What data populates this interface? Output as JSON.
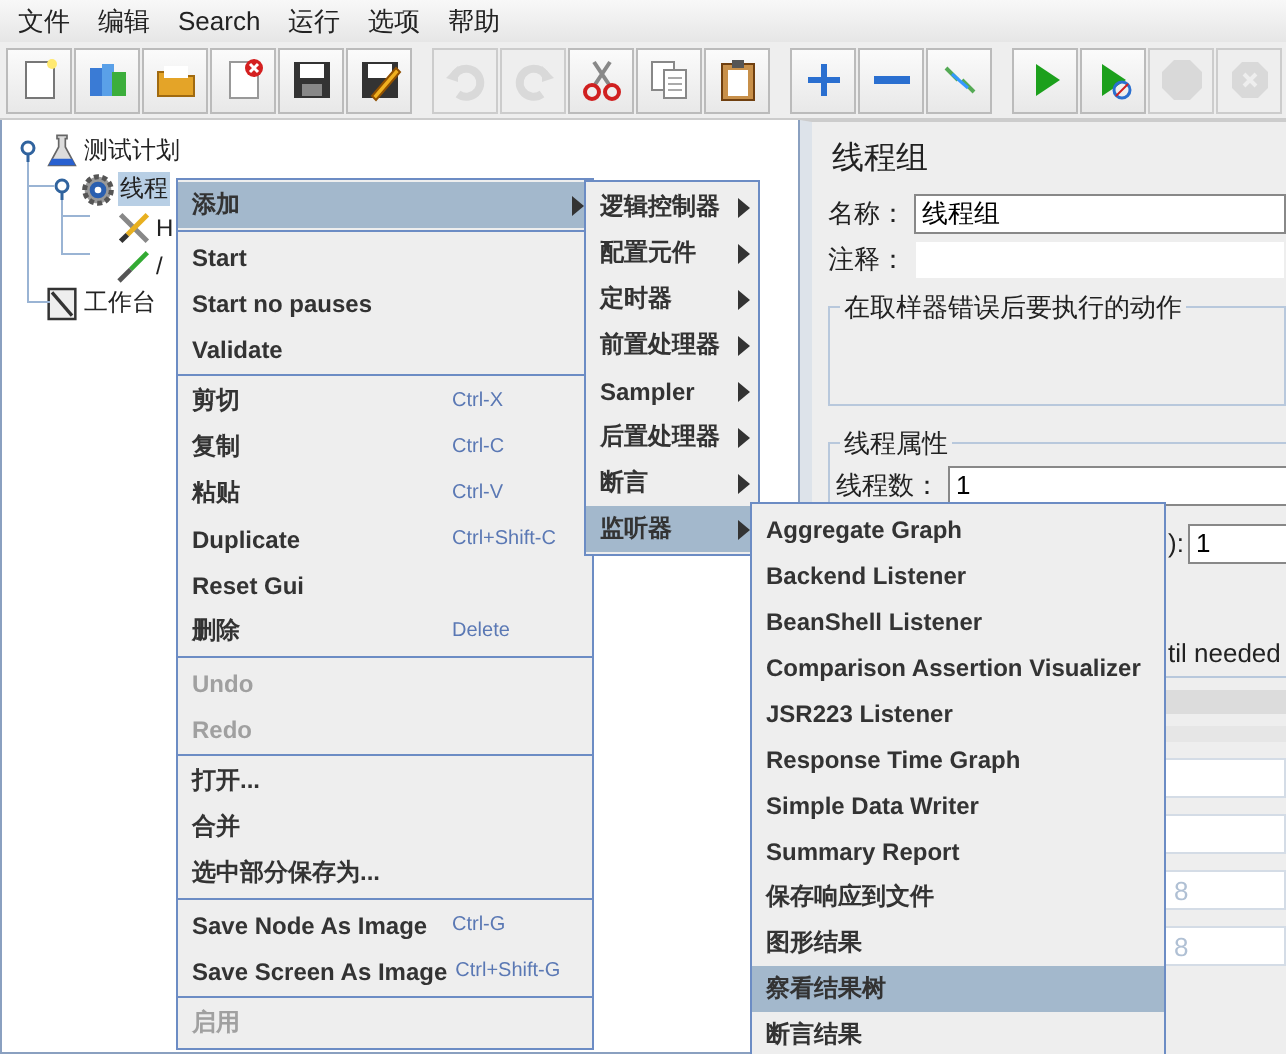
{
  "menubar": [
    "文件",
    "编辑",
    "Search",
    "运行",
    "选项",
    "帮助"
  ],
  "toolbar": [
    [
      {
        "kind": "new",
        "disabled": false
      },
      {
        "kind": "templates",
        "disabled": false
      },
      {
        "kind": "open",
        "disabled": false
      },
      {
        "kind": "close",
        "disabled": false
      },
      {
        "kind": "save",
        "disabled": false
      },
      {
        "kind": "save-as",
        "disabled": false
      }
    ],
    [
      {
        "kind": "undo",
        "disabled": true
      },
      {
        "kind": "redo",
        "disabled": true
      },
      {
        "kind": "cut",
        "disabled": false
      },
      {
        "kind": "copy",
        "disabled": false
      },
      {
        "kind": "paste",
        "disabled": false
      }
    ],
    [
      {
        "kind": "expand",
        "disabled": false
      },
      {
        "kind": "collapse",
        "disabled": false
      },
      {
        "kind": "toggle",
        "disabled": false
      }
    ],
    [
      {
        "kind": "start",
        "disabled": false
      },
      {
        "kind": "start-no-pause",
        "disabled": false
      },
      {
        "kind": "stop",
        "disabled": true
      },
      {
        "kind": "shutdown",
        "disabled": true
      }
    ]
  ],
  "tree": [
    {
      "label": "测试计划",
      "kind": "plan",
      "selected": false,
      "children": [
        {
          "label": "线程",
          "kind": "threads",
          "selected": true,
          "children": [
            {
              "label": "H",
              "kind": "tools",
              "selected": false
            },
            {
              "label": "/",
              "kind": "dropper",
              "selected": false
            }
          ]
        }
      ]
    },
    {
      "label": "工作台",
      "kind": "workbench",
      "selected": false
    }
  ],
  "panel": {
    "title": "线程组",
    "name_label": "名称：",
    "name_value": "线程组",
    "comment_label": "注释：",
    "error_group_title": "在取样器错误后要执行的动作",
    "thread_group_title": "线程属性",
    "threads_label": "线程数：",
    "threads_value": "1",
    "partial_label": "):",
    "partial_value": "1",
    "partial_text": "til needed",
    "faded_values": [
      "8",
      "8"
    ]
  },
  "context_menus": [
    {
      "items": [
        {
          "kind": "submenu",
          "label": "添加",
          "selected": true,
          "disabled": false
        },
        {
          "kind": "separator"
        },
        {
          "kind": "item",
          "label": "Start",
          "selected": false,
          "disabled": false
        },
        {
          "kind": "item",
          "label": "Start no pauses",
          "selected": false,
          "disabled": false
        },
        {
          "kind": "item",
          "label": "Validate",
          "selected": false,
          "disabled": false
        },
        {
          "kind": "separator"
        },
        {
          "kind": "item",
          "label": "剪切",
          "shortcut": "Ctrl-X",
          "selected": false,
          "disabled": false
        },
        {
          "kind": "item",
          "label": "复制",
          "shortcut": "Ctrl-C",
          "selected": false,
          "disabled": false
        },
        {
          "kind": "item",
          "label": "粘贴",
          "shortcut": "Ctrl-V",
          "selected": false,
          "disabled": false
        },
        {
          "kind": "item",
          "label": "Duplicate",
          "shortcut": "Ctrl+Shift-C",
          "selected": false,
          "disabled": false
        },
        {
          "kind": "item",
          "label": "Reset Gui",
          "selected": false,
          "disabled": false
        },
        {
          "kind": "item",
          "label": "删除",
          "shortcut": "Delete",
          "selected": false,
          "disabled": false
        },
        {
          "kind": "separator"
        },
        {
          "kind": "item",
          "label": "Undo",
          "selected": false,
          "disabled": true
        },
        {
          "kind": "item",
          "label": "Redo",
          "selected": false,
          "disabled": true
        },
        {
          "kind": "separator"
        },
        {
          "kind": "item",
          "label": "打开...",
          "selected": false,
          "disabled": false
        },
        {
          "kind": "item",
          "label": "合并",
          "selected": false,
          "disabled": false
        },
        {
          "kind": "item",
          "label": "选中部分保存为...",
          "selected": false,
          "disabled": false
        },
        {
          "kind": "separator"
        },
        {
          "kind": "item",
          "label": "Save Node As Image",
          "shortcut": "Ctrl-G",
          "selected": false,
          "disabled": false
        },
        {
          "kind": "item",
          "label": "Save Screen As Image",
          "shortcut": "Ctrl+Shift-G",
          "selected": false,
          "disabled": false
        },
        {
          "kind": "separator"
        },
        {
          "kind": "item",
          "label": "启用",
          "selected": false,
          "disabled": true
        }
      ]
    },
    {
      "items": [
        {
          "kind": "submenu",
          "label": "逻辑控制器",
          "selected": false,
          "disabled": false
        },
        {
          "kind": "submenu",
          "label": "配置元件",
          "selected": false,
          "disabled": false
        },
        {
          "kind": "submenu",
          "label": "定时器",
          "selected": false,
          "disabled": false
        },
        {
          "kind": "submenu",
          "label": "前置处理器",
          "selected": false,
          "disabled": false
        },
        {
          "kind": "submenu",
          "label": "Sampler",
          "selected": false,
          "disabled": false
        },
        {
          "kind": "submenu",
          "label": "后置处理器",
          "selected": false,
          "disabled": false
        },
        {
          "kind": "submenu",
          "label": "断言",
          "selected": false,
          "disabled": false
        },
        {
          "kind": "submenu",
          "label": "监听器",
          "selected": true,
          "disabled": false
        }
      ]
    },
    {
      "items": [
        {
          "kind": "item",
          "label": "Aggregate Graph",
          "selected": false,
          "disabled": false
        },
        {
          "kind": "item",
          "label": "Backend Listener",
          "selected": false,
          "disabled": false
        },
        {
          "kind": "item",
          "label": "BeanShell Listener",
          "selected": false,
          "disabled": false
        },
        {
          "kind": "item",
          "label": "Comparison Assertion Visualizer",
          "selected": false,
          "disabled": false
        },
        {
          "kind": "item",
          "label": "JSR223 Listener",
          "selected": false,
          "disabled": false
        },
        {
          "kind": "item",
          "label": "Response Time Graph",
          "selected": false,
          "disabled": false
        },
        {
          "kind": "item",
          "label": "Simple Data Writer",
          "selected": false,
          "disabled": false
        },
        {
          "kind": "item",
          "label": "Summary Report",
          "selected": false,
          "disabled": false
        },
        {
          "kind": "item",
          "label": "保存响应到文件",
          "selected": false,
          "disabled": false
        },
        {
          "kind": "item",
          "label": "图形结果",
          "selected": false,
          "disabled": false
        },
        {
          "kind": "item",
          "label": "察看结果树",
          "selected": true,
          "disabled": false
        },
        {
          "kind": "item",
          "label": "断言结果",
          "selected": false,
          "disabled": false
        }
      ]
    }
  ]
}
